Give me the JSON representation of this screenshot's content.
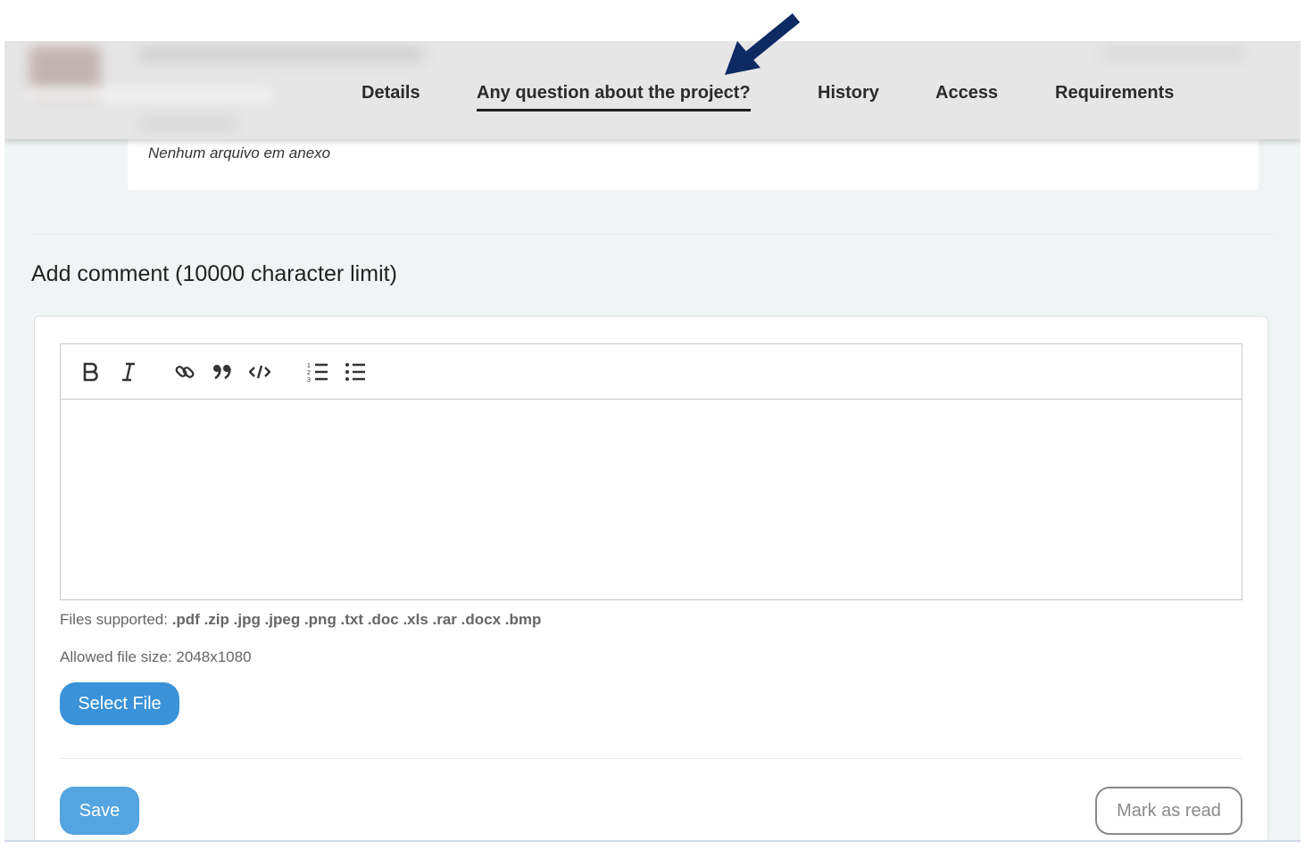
{
  "header": {
    "tabs": [
      {
        "label": "Details",
        "active": false
      },
      {
        "label": "Any question about the project?",
        "active": true
      },
      {
        "label": "History",
        "active": false
      },
      {
        "label": "Access",
        "active": false
      },
      {
        "label": "Requirements",
        "active": false
      }
    ]
  },
  "attachments": {
    "empty_text": "Nenhum arquivo em anexo"
  },
  "comment": {
    "title": "Add comment (10000 character limit)",
    "toolbar": [
      "bold-icon",
      "italic-icon",
      "link-icon",
      "quote-icon",
      "code-icon",
      "ordered-list-icon",
      "unordered-list-icon"
    ],
    "files_label": "Files supported:",
    "files_types": ".pdf .zip .jpg .jpeg .png .txt .doc .xls .rar .docx .bmp",
    "size_text": "Allowed file size: 2048x1080",
    "select_file_label": "Select File",
    "save_label": "Save",
    "mark_read_label": "Mark as read"
  },
  "colors": {
    "primary": "#3a92d8",
    "arrow": "#0d2a63"
  }
}
